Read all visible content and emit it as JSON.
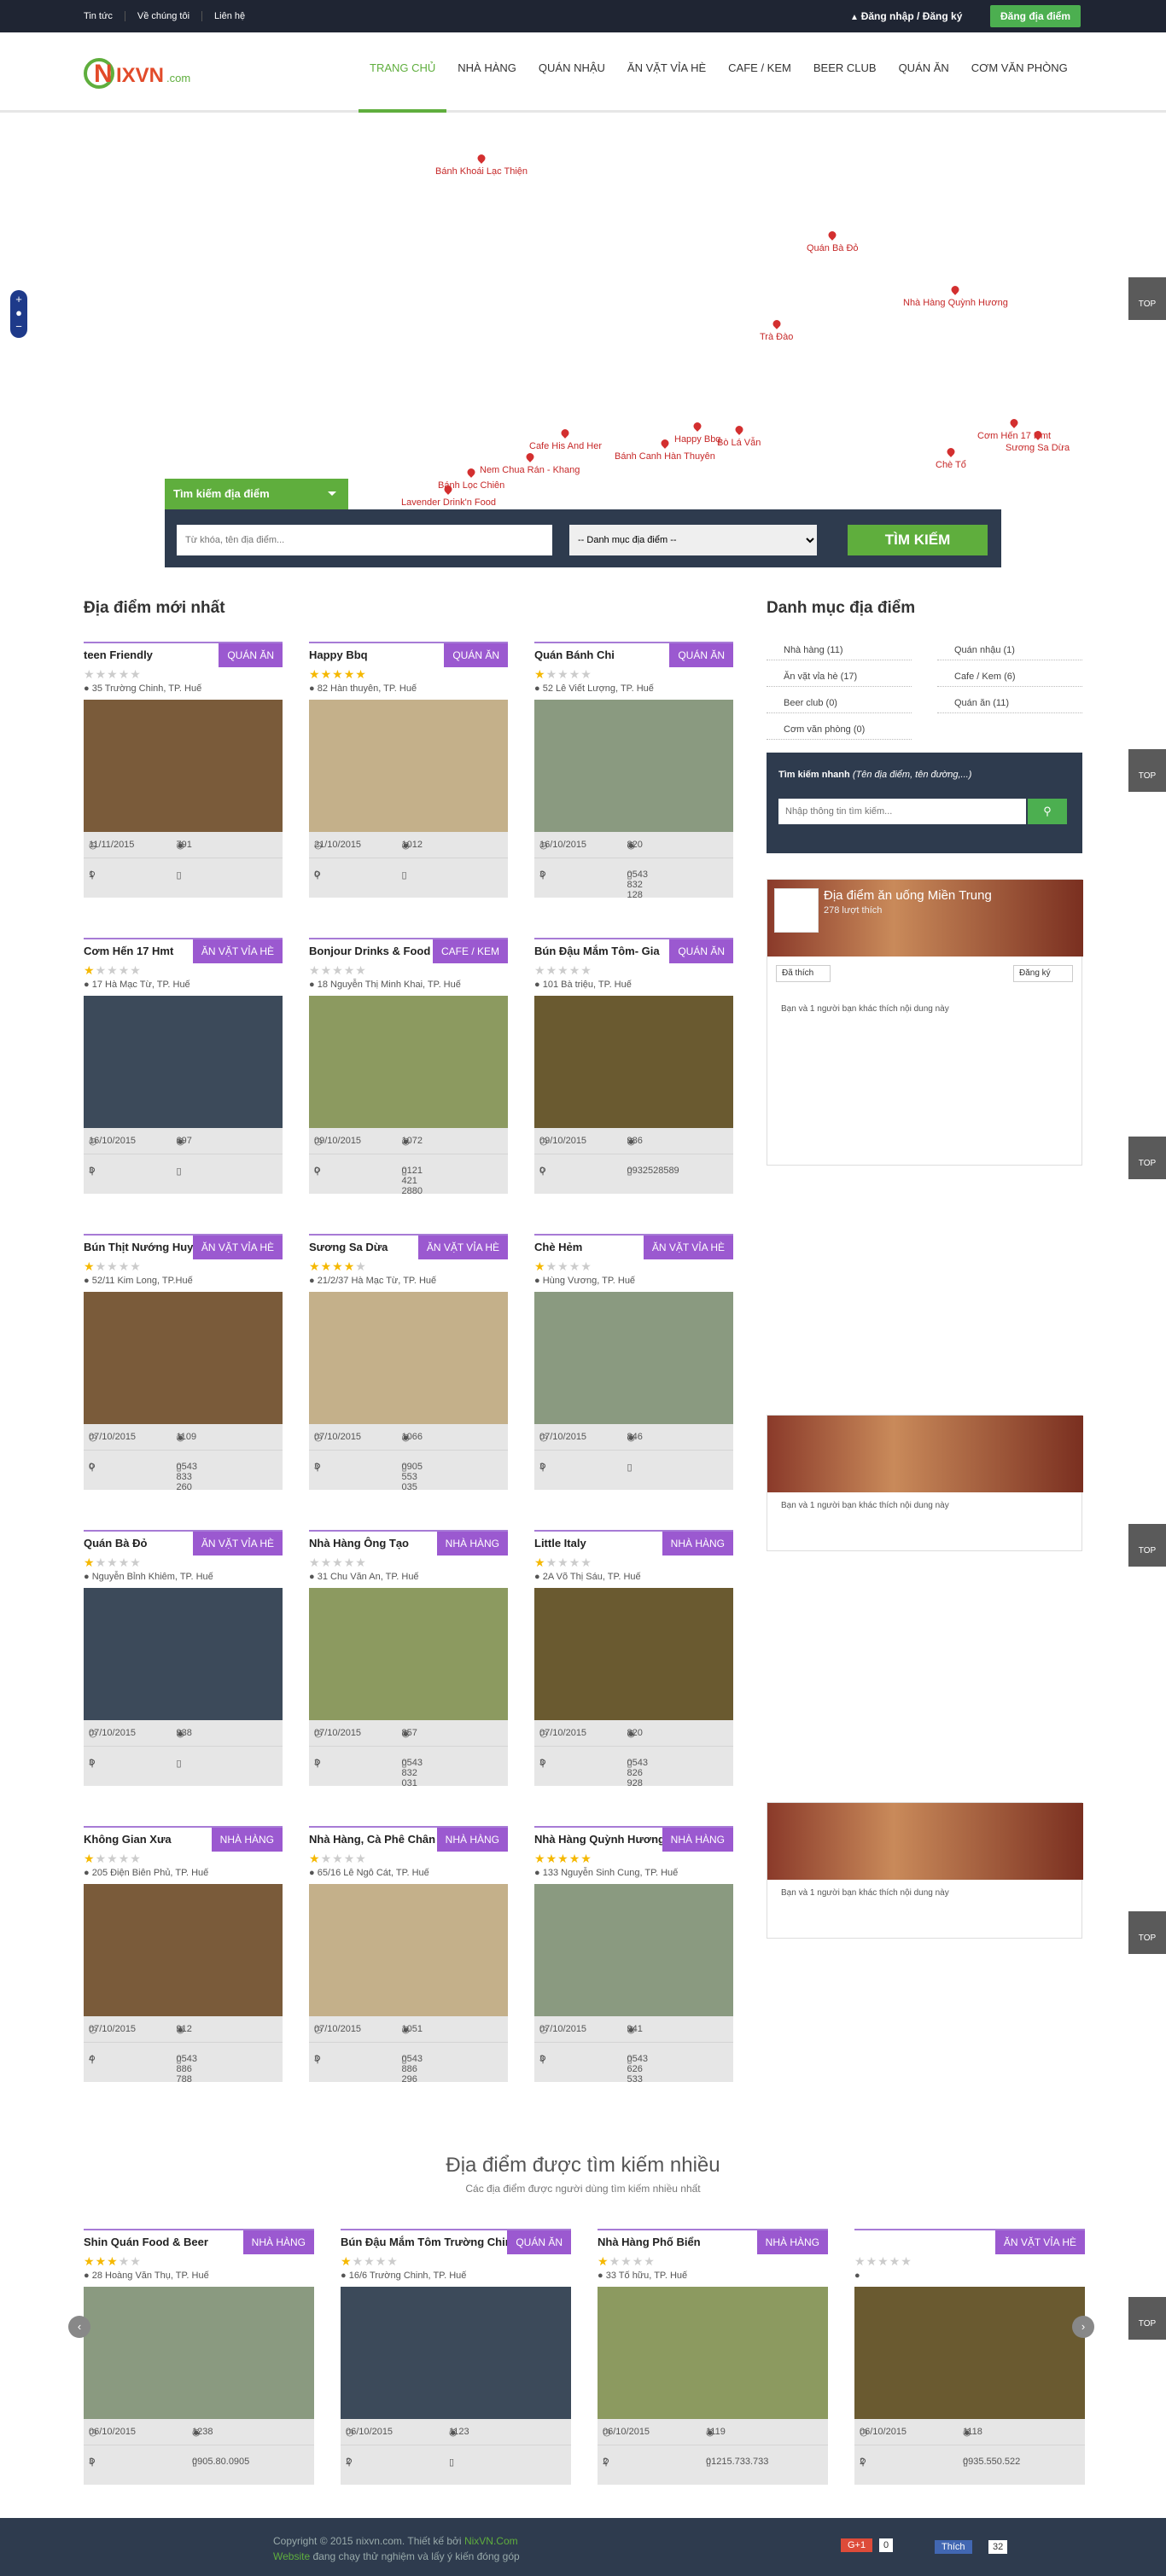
{
  "topbar": {
    "links": [
      "Tin tức",
      "Về chúng tôi",
      "Liên hệ"
    ],
    "login": "Đăng nhập / Đăng ký",
    "register": "Đăng địa điểm"
  },
  "logo": "NIXVN.com",
  "nav": [
    "TRANG CHỦ",
    "NHÀ HÀNG",
    "QUÁN NHẬU",
    "ĂN VẶT VỈA HÈ",
    "CAFE / KEM",
    "BEER CLUB",
    "QUÁN ĂN",
    "CƠM VĂN PHÒNG"
  ],
  "map_pins": [
    "Bánh Khoái Lạc Thiện",
    "Quán Bà Đỏ",
    "Nhà Hàng Quỳnh Hương",
    "Trà Đào",
    "Cafe His And Her",
    "Bánh Canh Hàn Thuyên",
    "Happy Bbq",
    "Bò Lá Vẫn",
    "Nem Chua Rán - Khang",
    "Bánh Lọc Chiên",
    "Lavender Drink'n Food",
    "Cơm Hến 17 Hmt",
    "Sương Sa Dừa",
    "Chè Tổ"
  ],
  "search": {
    "tab": "Tìm kiếm địa điểm",
    "placeholder": "Từ khóa, tên địa điểm...",
    "select": "-- Danh mục địa điểm --",
    "button": "TÌM KIẾM"
  },
  "latest_title": "Địa điểm mới nhất",
  "cards": [
    {
      "name": "teen Friendly",
      "cat": "QUÁN ĂN",
      "stars": 0,
      "addr": "35 Trường Chinh, TP. Huế",
      "date": "11/11/2015",
      "views": "791",
      "q": "1",
      "phone": ""
    },
    {
      "name": "Happy Bbq",
      "cat": "QUÁN ĂN",
      "stars": 5,
      "addr": "82 Hàn thuyên, TP. Huế",
      "date": "21/10/2015",
      "views": "1012",
      "q": "0",
      "phone": ""
    },
    {
      "name": "Quán Bánh Chi",
      "cat": "QUÁN ĂN",
      "stars": 1,
      "addr": "52 Lê Viết Lượng, TP. Huế",
      "date": "16/10/2015",
      "views": "820",
      "q": "3",
      "phone": "0543 832 128"
    },
    {
      "name": "Cơm Hến 17 Hmt",
      "cat": "ĂN VẶT VỈA HÈ",
      "stars": 1,
      "addr": "17 Hà Mạc Từ, TP. Huế",
      "date": "16/10/2015",
      "views": "697",
      "q": "3",
      "phone": ""
    },
    {
      "name": "Bonjour Drinks & Food",
      "cat": "CAFE / KEM",
      "stars": 0,
      "addr": "18 Nguyễn Thị Minh Khai, TP. Huế",
      "date": "09/10/2015",
      "views": "1072",
      "q": "0",
      "phone": "0121 421 2880"
    },
    {
      "name": "Bún Đậu Mắm Tôm- Gia",
      "cat": "QUÁN ĂN",
      "stars": 0,
      "addr": "101 Bà triệu, TP. Huế",
      "date": "09/10/2015",
      "views": "986",
      "q": "0",
      "phone": "0932528589"
    },
    {
      "name": "Bún Thịt Nướng Huyền Anh",
      "cat": "ĂN VẶT VỈA HÈ",
      "stars": 1,
      "addr": "52/11 Kim Long, TP.Huế",
      "date": "07/10/2015",
      "views": "1109",
      "q": "0",
      "phone": "0543 833 260"
    },
    {
      "name": "Sương Sa Dừa",
      "cat": "ĂN VẶT VỈA HÈ",
      "stars": 4,
      "addr": "21/2/37 Hà Mạc Từ, TP. Huế",
      "date": "07/10/2015",
      "views": "1066",
      "q": "3",
      "phone": "0905 553 035"
    },
    {
      "name": "Chè Hẻm",
      "cat": "ĂN VẶT VỈA HÈ",
      "stars": 1,
      "addr": "Hùng Vương, TP. Huế",
      "date": "07/10/2015",
      "views": "846",
      "q": "3",
      "phone": ""
    },
    {
      "name": "Quán Bà Đỏ",
      "cat": "ĂN VẶT VỈA HÈ",
      "stars": 1,
      "addr": "Nguyễn Bỉnh Khiêm, TP. Huế",
      "date": "07/10/2015",
      "views": "938",
      "q": "3",
      "phone": ""
    },
    {
      "name": "Nhà Hàng Ông Tạo",
      "cat": "NHÀ HÀNG",
      "stars": 0,
      "addr": "31 Chu Văn An, TP. Huế",
      "date": "07/10/2015",
      "views": "857",
      "q": "3",
      "phone": "0543 832 031"
    },
    {
      "name": "Little Italy",
      "cat": "NHÀ HÀNG",
      "stars": 1,
      "addr": "2A Võ Thị Sáu, TP. Huế",
      "date": "07/10/2015",
      "views": "820",
      "q": "3",
      "phone": "0543 826 928"
    },
    {
      "name": "Không Gian Xưa",
      "cat": "NHÀ HÀNG",
      "stars": 1,
      "addr": "205 Điện Biên Phủ, TP. Huế",
      "date": "07/10/2015",
      "views": "912",
      "q": "4",
      "phone": "0543 886 788"
    },
    {
      "name": "Nhà Hàng, Cà Phê Chân Đồi",
      "cat": "NHÀ HÀNG",
      "stars": 1,
      "addr": "65/16 Lê Ngô Cát, TP. Huế",
      "date": "07/10/2015",
      "views": "1051",
      "q": "3",
      "phone": "0543 886 296"
    },
    {
      "name": "Nhà Hàng Quỳnh Hương",
      "cat": "NHÀ HÀNG",
      "stars": 5,
      "addr": "133 Nguyễn Sinh Cung, TP. Huế",
      "date": "07/10/2015",
      "views": "941",
      "q": "3",
      "phone": "0543 626 533"
    }
  ],
  "sidebar": {
    "title": "Danh mục địa điểm",
    "cats": [
      "Nhà hàng (11)",
      "Quán nhậu (1)",
      "Ăn vặt vỉa hè (17)",
      "Cafe / Kem (6)",
      "Beer club (0)",
      "Quán ăn (11)",
      "Cơm văn phòng (0)"
    ],
    "quick_title": "Tìm kiếm nhanh",
    "quick_hint": "(Tên địa điểm, tên đường,...)",
    "quick_placeholder": "Nhập thông tin tìm kiếm...",
    "fb_name": "Địa điểm ăn uống Miền Trung",
    "fb_likes": "278 lượt thích",
    "fb_liked": "Đã thích",
    "fb_signup": "Đăng ký",
    "fb_friends": "Bạn và 1 người bạn khác thích nội dung này"
  },
  "most": {
    "title": "Địa điểm được tìm kiếm nhiều",
    "subtitle": "Các địa điểm được người dùng tìm kiếm nhiều nhất"
  },
  "most_cards": [
    {
      "name": "Shin Quán Food & Beer",
      "cat": "NHÀ HÀNG",
      "stars": 3,
      "addr": "28 Hoàng Văn Thụ, TP. Huế",
      "date": "06/10/2015",
      "views": "1238",
      "q": "3",
      "phone": "0905.80.0905"
    },
    {
      "name": "Bún Đậu Mắm Tôm Trường Chinh",
      "cat": "QUÁN ĂN",
      "stars": 1,
      "addr": "16/6 Trường Chinh, TP. Huế",
      "date": "06/10/2015",
      "views": "1123",
      "q": "2",
      "phone": ""
    },
    {
      "name": "Nhà Hàng Phố Biển",
      "cat": "NHÀ HÀNG",
      "stars": 1,
      "addr": "33 Tố hữu, TP. Huế",
      "date": "06/10/2015",
      "views": "1119",
      "q": "2",
      "phone": "01215.733.733"
    },
    {
      "name": "",
      "cat": "ĂN VẶT VỈA HÈ",
      "stars": 0,
      "addr": "",
      "date": "06/10/2015",
      "views": "1118",
      "q": "2",
      "phone": "0935.550.522"
    }
  ],
  "footer": {
    "copy": "Copyright © 2015 nixvn.com. Thiết kế bởi",
    "brand": "NixVN.Com",
    "line2": "Website",
    "line2b": "đang chạy thử nghiệm và lấy ý kiến đóng góp",
    "gplus": "G+1",
    "gcount": "0",
    "like": "Thích",
    "lcount": "32"
  },
  "top_label": "TOP"
}
